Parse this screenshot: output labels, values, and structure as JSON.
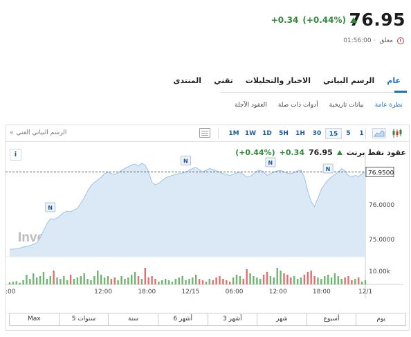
{
  "quote": {
    "price": "76.95",
    "change": "+0.34",
    "change_pct": "(+0.44%)",
    "status": "مغلق",
    "time": "01:56:00 ·"
  },
  "tabs": [
    {
      "label": "عام",
      "active": true
    },
    {
      "label": "الرسم البياني",
      "active": false
    },
    {
      "label": "الاخبار والتحليلات",
      "active": false
    },
    {
      "label": "تقني",
      "active": false
    },
    {
      "label": "المنتدى",
      "active": false
    }
  ],
  "subtabs": [
    {
      "label": "نظرة عامة",
      "active": true
    },
    {
      "label": "بيانات تاريخية",
      "active": false
    },
    {
      "label": "أدوات ذات صلة",
      "active": false
    },
    {
      "label": "العقود الآجلة",
      "active": false
    }
  ],
  "toolbar": {
    "chart_link": "الرسم البياني الفني",
    "chart_link_arrow": "«",
    "intervals": [
      {
        "label": "1M",
        "active": false
      },
      {
        "label": "1W",
        "active": false
      },
      {
        "label": "1D",
        "active": false
      },
      {
        "label": "5H",
        "active": false
      },
      {
        "label": "1H",
        "active": false
      },
      {
        "label": "30",
        "active": false
      },
      {
        "label": "15",
        "active": true
      },
      {
        "label": "5",
        "active": false
      },
      {
        "label": "1",
        "active": false
      }
    ]
  },
  "chart_header": {
    "title": "عقود نفط برنت",
    "price": "76.95",
    "change": "+0.34",
    "change_pct": "(+0.44%)",
    "info_label": "i"
  },
  "chart_data": {
    "type": "area",
    "y_ticks": [
      "76.9500",
      "76.0000",
      "75.0000"
    ],
    "last_value": 76.95,
    "last_label": "76.9500",
    "ylim": [
      74.5,
      77.3
    ],
    "volume_label": "10.00k",
    "x_ticks": [
      ":00",
      "12:00",
      "18:00",
      "12/15",
      "06:00",
      "12:00",
      "18:00",
      "12/1"
    ],
    "watermark": "Investing",
    "watermark_suffix": ".com",
    "news_marker_label": "N",
    "values": [
      74.72,
      74.72,
      74.73,
      74.75,
      74.78,
      74.8,
      74.82,
      74.86,
      74.9,
      75.05,
      75.25,
      75.45,
      75.6,
      75.58,
      75.62,
      75.7,
      75.78,
      75.82,
      75.8,
      75.85,
      75.9,
      76.05,
      76.2,
      76.4,
      76.55,
      76.65,
      76.72,
      76.8,
      76.9,
      76.95,
      76.9,
      76.88,
      76.92,
      77.0,
      77.05,
      77.1,
      77.15,
      77.18,
      77.12,
      77.2,
      77.15,
      76.95,
      76.65,
      76.58,
      76.62,
      76.7,
      76.78,
      76.82,
      76.85,
      76.88,
      76.9,
      76.92,
      76.95,
      77.0,
      77.05,
      77.08,
      77.02,
      76.95,
      77.0,
      77.05,
      77.02,
      76.98,
      76.95,
      76.9,
      76.88,
      76.85,
      76.88,
      76.92,
      76.95,
      76.88,
      76.8,
      76.82,
      76.9,
      76.98,
      77.0,
      76.95,
      76.85,
      76.9,
      76.95,
      76.98,
      77.0,
      76.95,
      76.92,
      76.9,
      76.93,
      76.98,
      77.0,
      76.8,
      76.4,
      76.1,
      75.95,
      76.2,
      76.45,
      76.6,
      76.72,
      76.8,
      76.88,
      76.95,
      77.05,
      76.98,
      76.85,
      76.8,
      76.85,
      76.82,
      76.9,
      76.95
    ],
    "volumes": [
      0.08,
      0.1,
      0.12,
      0.06,
      0.15,
      0.35,
      0.2,
      0.4,
      0.25,
      0.3,
      0.45,
      0.2,
      0.3,
      0.5,
      0.25,
      0.2,
      0.3,
      0.15,
      0.35,
      0.2,
      0.25,
      0.3,
      0.4,
      0.2,
      0.15,
      0.3,
      0.5,
      0.35,
      0.25,
      0.3,
      0.2,
      0.25,
      0.15,
      0.3,
      0.2,
      0.25,
      0.35,
      0.45,
      0.3,
      0.2,
      0.6,
      0.25,
      0.3,
      0.2,
      0.1,
      0.15,
      0.2,
      0.15,
      0.1,
      0.2,
      0.25,
      0.3,
      0.15,
      0.2,
      0.25,
      0.35,
      0.2,
      0.15,
      0.1,
      0.2,
      0.15,
      0.25,
      0.3,
      0.2,
      0.15,
      0.1,
      0.25,
      0.35,
      0.3,
      0.2,
      0.55,
      0.4,
      0.3,
      0.25,
      0.2,
      0.35,
      0.45,
      0.3,
      0.25,
      0.6,
      0.5,
      0.4,
      0.35,
      0.25,
      0.3,
      0.2,
      0.25,
      0.35,
      0.45,
      0.5,
      0.3,
      0.25,
      0.2,
      0.3,
      0.35,
      0.25,
      0.4,
      0.3,
      0.2,
      0.25,
      0.3,
      0.15,
      0.2,
      0.25,
      0.1,
      0.15
    ],
    "news_at": [
      12,
      52,
      77,
      94
    ]
  },
  "periods": [
    "يوم",
    "أسبوع",
    "شهر",
    "3 أشهر",
    "6 أشهر",
    "سنة",
    "5 سنوات",
    "Max"
  ],
  "colors": {
    "accent": "#1a6fc2",
    "up": "#2f8a3a",
    "down": "#d33",
    "area_fill": "#dbe9f6",
    "area_line": "#9cc3e6"
  }
}
